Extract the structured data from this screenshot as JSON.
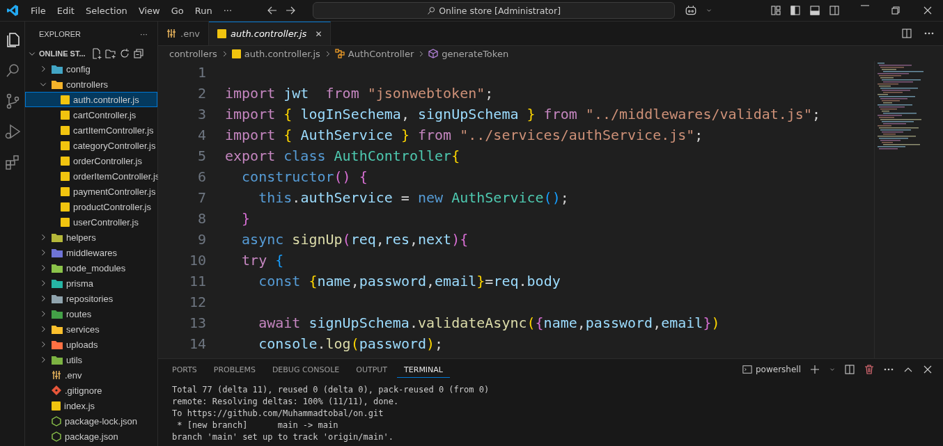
{
  "title_bar": {
    "menu": [
      "File",
      "Edit",
      "Selection",
      "View",
      "Go",
      "Run",
      "···"
    ],
    "command_center": "Online store [Administrator]"
  },
  "activity_bar": [
    {
      "kind": "explorer",
      "selected": true
    },
    {
      "kind": "search",
      "selected": false
    },
    {
      "kind": "source-control",
      "selected": false
    },
    {
      "kind": "run-debug",
      "selected": false
    },
    {
      "kind": "extensions",
      "selected": false
    }
  ],
  "sidebar": {
    "title": "EXPLORER",
    "more": "···",
    "workspace": "ONLINE ST...",
    "tree": [
      {
        "label": "config",
        "kind": "folder",
        "color": "#42a5c5",
        "expanded": false,
        "selected": false
      },
      {
        "label": "controllers",
        "kind": "folder",
        "color": "#f5b42a",
        "expanded": true,
        "selected": false,
        "children": [
          {
            "label": "auth.controller.js",
            "kind": "js",
            "selected": true
          },
          {
            "label": "cartController.js",
            "kind": "js",
            "selected": false
          },
          {
            "label": "cartItemController.js",
            "kind": "js",
            "selected": false
          },
          {
            "label": "categoryController.js",
            "kind": "js",
            "selected": false
          },
          {
            "label": "orderController.js",
            "kind": "js",
            "selected": false
          },
          {
            "label": "orderItemController.js",
            "kind": "js",
            "selected": false
          },
          {
            "label": "paymentController.js",
            "kind": "js",
            "selected": false
          },
          {
            "label": "productController.js",
            "kind": "js",
            "selected": false
          },
          {
            "label": "userController.js",
            "kind": "js",
            "selected": false
          }
        ]
      },
      {
        "label": "helpers",
        "kind": "folder",
        "color": "#b5b83a",
        "expanded": false,
        "selected": false
      },
      {
        "label": "middlewares",
        "kind": "folder",
        "color": "#6f74d6",
        "expanded": false,
        "selected": false
      },
      {
        "label": "node_modules",
        "kind": "folder",
        "color": "#8bc34a",
        "expanded": false,
        "selected": false
      },
      {
        "label": "prisma",
        "kind": "folder",
        "color": "#26b5a5",
        "expanded": false,
        "selected": false
      },
      {
        "label": "repositories",
        "kind": "folder",
        "color": "#90a4ae",
        "expanded": false,
        "selected": false
      },
      {
        "label": "routes",
        "kind": "folder",
        "color": "#43a047",
        "expanded": false,
        "selected": false
      },
      {
        "label": "services",
        "kind": "folder",
        "color": "#fbc02d",
        "expanded": false,
        "selected": false
      },
      {
        "label": "uploads",
        "kind": "folder",
        "color": "#ff7043",
        "expanded": false,
        "selected": false
      },
      {
        "label": "utils",
        "kind": "folder",
        "color": "#7cb342",
        "expanded": false,
        "selected": false
      },
      {
        "label": ".env",
        "kind": "env",
        "selected": false
      },
      {
        "label": ".gitignore",
        "kind": "git",
        "selected": false
      },
      {
        "label": "index.js",
        "kind": "js",
        "selected": false
      },
      {
        "label": "package-lock.json",
        "kind": "node",
        "selected": false
      },
      {
        "label": "package.json",
        "kind": "node",
        "selected": false
      }
    ]
  },
  "tabs": [
    {
      "label": ".env",
      "kind": "env",
      "selected": false
    },
    {
      "label": "auth.controller.js",
      "kind": "js",
      "selected": true,
      "close": "✕"
    }
  ],
  "breadcrumbs": [
    {
      "label": "controllers",
      "kind": "folder"
    },
    {
      "label": "auth.controller.js",
      "kind": "js"
    },
    {
      "label": "AuthController",
      "kind": "class"
    },
    {
      "label": "generateToken",
      "kind": "method"
    }
  ],
  "editor": {
    "lines": [
      {
        "number": "1"
      },
      {
        "number": "2",
        "tokens": [
          {
            "kind": "kw",
            "text": "import"
          },
          {
            "kind": "var",
            "text": " jwt"
          },
          {
            "kind": "kw",
            "text": "  from"
          },
          {
            "kind": "str",
            "text": " \"jsonwebtoken\""
          },
          {
            "kind": "p",
            "text": ";"
          }
        ]
      },
      {
        "number": "3",
        "tokens": [
          {
            "kind": "kw",
            "text": "import"
          },
          {
            "kind": "b1",
            "text": " {"
          },
          {
            "kind": "var",
            "text": " logInSechema"
          },
          {
            "kind": "p",
            "text": ","
          },
          {
            "kind": "var",
            "text": " signUpSchema"
          },
          {
            "kind": "b1",
            "text": " }"
          },
          {
            "kind": "kw",
            "text": " from"
          },
          {
            "kind": "str",
            "text": " \"../middlewares/validat.js\""
          },
          {
            "kind": "p",
            "text": ";"
          }
        ]
      },
      {
        "number": "4",
        "tokens": [
          {
            "kind": "kw",
            "text": "import"
          },
          {
            "kind": "b1",
            "text": " {"
          },
          {
            "kind": "var",
            "text": " AuthService"
          },
          {
            "kind": "b1",
            "text": " }"
          },
          {
            "kind": "kw",
            "text": " from"
          },
          {
            "kind": "str",
            "text": " \"../services/authService.js\""
          },
          {
            "kind": "p",
            "text": ";"
          }
        ]
      },
      {
        "number": "5",
        "tokens": [
          {
            "kind": "kw",
            "text": "export"
          },
          {
            "kind": "st",
            "text": " class"
          },
          {
            "kind": "cls",
            "text": " AuthController"
          },
          {
            "kind": "b1",
            "text": "{"
          }
        ]
      },
      {
        "number": "6",
        "tokens": [
          {
            "kind": "st",
            "text": "  constructor"
          },
          {
            "kind": "b2",
            "text": "()"
          },
          {
            "kind": "b2",
            "text": " {"
          }
        ]
      },
      {
        "number": "7",
        "tokens": [
          {
            "kind": "st",
            "text": "    this"
          },
          {
            "kind": "p",
            "text": "."
          },
          {
            "kind": "var",
            "text": "authService"
          },
          {
            "kind": "p",
            "text": " ="
          },
          {
            "kind": "st",
            "text": " new"
          },
          {
            "kind": "cls",
            "text": " AuthService"
          },
          {
            "kind": "b3",
            "text": "()"
          },
          {
            "kind": "p",
            "text": ";"
          }
        ]
      },
      {
        "number": "8",
        "tokens": [
          {
            "kind": "b2",
            "text": "  }"
          }
        ]
      },
      {
        "number": "9",
        "tokens": [
          {
            "kind": "st",
            "text": "  async"
          },
          {
            "kind": "fn",
            "text": " signUp"
          },
          {
            "kind": "b2",
            "text": "("
          },
          {
            "kind": "var",
            "text": "req"
          },
          {
            "kind": "p",
            "text": ","
          },
          {
            "kind": "var",
            "text": "res"
          },
          {
            "kind": "p",
            "text": ","
          },
          {
            "kind": "var",
            "text": "next"
          },
          {
            "kind": "b2",
            "text": ")"
          },
          {
            "kind": "b2",
            "text": "{"
          }
        ]
      },
      {
        "number": "10",
        "tokens": [
          {
            "kind": "kw",
            "text": "  try"
          },
          {
            "kind": "b3",
            "text": " {"
          }
        ]
      },
      {
        "number": "11",
        "tokens": [
          {
            "kind": "st",
            "text": "    const"
          },
          {
            "kind": "b1",
            "text": " {"
          },
          {
            "kind": "var",
            "text": "name"
          },
          {
            "kind": "p",
            "text": ","
          },
          {
            "kind": "var",
            "text": "password"
          },
          {
            "kind": "p",
            "text": ","
          },
          {
            "kind": "var",
            "text": "email"
          },
          {
            "kind": "b1",
            "text": "}"
          },
          {
            "kind": "p",
            "text": "="
          },
          {
            "kind": "var",
            "text": "req"
          },
          {
            "kind": "p",
            "text": "."
          },
          {
            "kind": "var",
            "text": "body"
          }
        ]
      },
      {
        "number": "12"
      },
      {
        "number": "13",
        "tokens": [
          {
            "kind": "kw",
            "text": "    await"
          },
          {
            "kind": "var",
            "text": " signUpSchema"
          },
          {
            "kind": "p",
            "text": "."
          },
          {
            "kind": "fn",
            "text": "validateAsync"
          },
          {
            "kind": "b1",
            "text": "("
          },
          {
            "kind": "b2",
            "text": "{"
          },
          {
            "kind": "var",
            "text": "name"
          },
          {
            "kind": "p",
            "text": ","
          },
          {
            "kind": "var",
            "text": "password"
          },
          {
            "kind": "p",
            "text": ","
          },
          {
            "kind": "var",
            "text": "email"
          },
          {
            "kind": "b2",
            "text": "}"
          },
          {
            "kind": "b1",
            "text": ")"
          }
        ]
      },
      {
        "number": "14",
        "tokens": [
          {
            "kind": "var",
            "text": "    console"
          },
          {
            "kind": "p",
            "text": "."
          },
          {
            "kind": "fn",
            "text": "log"
          },
          {
            "kind": "b1",
            "text": "("
          },
          {
            "kind": "var",
            "text": "password"
          },
          {
            "kind": "b1",
            "text": ")"
          },
          {
            "kind": "p",
            "text": ";"
          }
        ]
      }
    ]
  },
  "panel": {
    "tabs": [
      {
        "label": "PORTS",
        "selected": false
      },
      {
        "label": "PROBLEMS",
        "selected": false
      },
      {
        "label": "DEBUG CONSOLE",
        "selected": false
      },
      {
        "label": "OUTPUT",
        "selected": false
      },
      {
        "label": "TERMINAL",
        "selected": true
      }
    ],
    "profile": "powershell",
    "terminal": [
      "Total 77 (delta 11), reused 0 (delta 0), pack-reused 0 (from 0)",
      "remote: Resolving deltas: 100% (11/11), done.",
      "To https://github.com/Muhammadtobal/on.git",
      " * [new branch]      main -> main",
      "branch 'main' set up to track 'origin/main'."
    ]
  }
}
